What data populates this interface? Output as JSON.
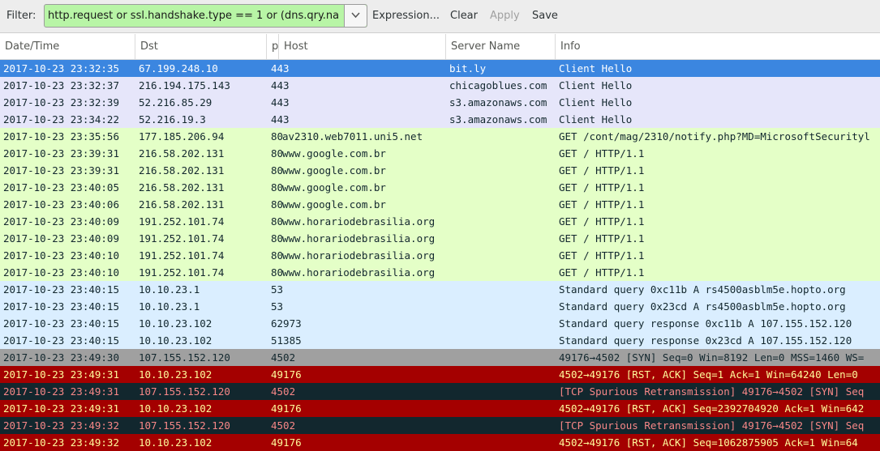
{
  "toolbar": {
    "filter_label": "Filter:",
    "filter_value": "http.request or ssl.handshake.type == 1 or (dns.qry.na",
    "expression_label": "Expression...",
    "clear_label": "Clear",
    "apply_label": "Apply",
    "save_label": "Save",
    "filter_valid_color": "#b8f5a6"
  },
  "columns": [
    "Date/Time",
    "Dst",
    "port",
    "Host",
    "Server Name",
    "Info"
  ],
  "row_styles": {
    "selected": {
      "bg": "#3b86e0",
      "fg": "#ffffff"
    },
    "tls": {
      "bg": "#e6e6fa",
      "fg": "#12272e"
    },
    "http": {
      "bg": "#e4ffc7",
      "fg": "#12272e"
    },
    "dns": {
      "bg": "#daeeff",
      "fg": "#12272e"
    },
    "tcp_gray": {
      "bg": "#a0a0a0",
      "fg": "#12272e"
    },
    "tcp_rst": {
      "bg": "#a40000",
      "fg": "#fffc9c"
    },
    "tcp_bad": {
      "bg": "#12272e",
      "fg": "#f78787"
    }
  },
  "rows": [
    {
      "dt": "2017-10-23 23:32:35",
      "dst": "67.199.248.10",
      "port": "443",
      "host": "",
      "server": "bit.ly",
      "info": "Client Hello",
      "style": "selected"
    },
    {
      "dt": "2017-10-23 23:32:37",
      "dst": "216.194.175.143",
      "port": "443",
      "host": "",
      "server": "chicagoblues.com",
      "info": "Client Hello",
      "style": "tls"
    },
    {
      "dt": "2017-10-23 23:32:39",
      "dst": "52.216.85.29",
      "port": "443",
      "host": "",
      "server": "s3.amazonaws.com",
      "info": "Client Hello",
      "style": "tls"
    },
    {
      "dt": "2017-10-23 23:34:22",
      "dst": "52.216.19.3",
      "port": "443",
      "host": "",
      "server": "s3.amazonaws.com",
      "info": "Client Hello",
      "style": "tls"
    },
    {
      "dt": "2017-10-23 23:35:56",
      "dst": "177.185.206.94",
      "port": "80",
      "host": "av2310.web7011.uni5.net",
      "server": "",
      "info": "GET /cont/mag/2310/notify.php?MD=MicrosoftSecurityl",
      "style": "http"
    },
    {
      "dt": "2017-10-23 23:39:31",
      "dst": "216.58.202.131",
      "port": "80",
      "host": "www.google.com.br",
      "server": "",
      "info": "GET / HTTP/1.1",
      "style": "http"
    },
    {
      "dt": "2017-10-23 23:39:31",
      "dst": "216.58.202.131",
      "port": "80",
      "host": "www.google.com.br",
      "server": "",
      "info": "GET / HTTP/1.1",
      "style": "http"
    },
    {
      "dt": "2017-10-23 23:40:05",
      "dst": "216.58.202.131",
      "port": "80",
      "host": "www.google.com.br",
      "server": "",
      "info": "GET / HTTP/1.1",
      "style": "http"
    },
    {
      "dt": "2017-10-23 23:40:06",
      "dst": "216.58.202.131",
      "port": "80",
      "host": "www.google.com.br",
      "server": "",
      "info": "GET / HTTP/1.1",
      "style": "http"
    },
    {
      "dt": "2017-10-23 23:40:09",
      "dst": "191.252.101.74",
      "port": "80",
      "host": "www.horariodebrasilia.org",
      "server": "",
      "info": "GET / HTTP/1.1",
      "style": "http"
    },
    {
      "dt": "2017-10-23 23:40:09",
      "dst": "191.252.101.74",
      "port": "80",
      "host": "www.horariodebrasilia.org",
      "server": "",
      "info": "GET / HTTP/1.1",
      "style": "http"
    },
    {
      "dt": "2017-10-23 23:40:10",
      "dst": "191.252.101.74",
      "port": "80",
      "host": "www.horariodebrasilia.org",
      "server": "",
      "info": "GET / HTTP/1.1",
      "style": "http"
    },
    {
      "dt": "2017-10-23 23:40:10",
      "dst": "191.252.101.74",
      "port": "80",
      "host": "www.horariodebrasilia.org",
      "server": "",
      "info": "GET / HTTP/1.1",
      "style": "http"
    },
    {
      "dt": "2017-10-23 23:40:15",
      "dst": "10.10.23.1",
      "port": "53",
      "host": "",
      "server": "",
      "info": "Standard query 0xc11b  A rs4500asblm5e.hopto.org",
      "style": "dns"
    },
    {
      "dt": "2017-10-23 23:40:15",
      "dst": "10.10.23.1",
      "port": "53",
      "host": "",
      "server": "",
      "info": "Standard query 0x23cd  A rs4500asblm5e.hopto.org",
      "style": "dns"
    },
    {
      "dt": "2017-10-23 23:40:15",
      "dst": "10.10.23.102",
      "port": "62973",
      "host": "",
      "server": "",
      "info": "Standard query response 0xc11b  A 107.155.152.120",
      "style": "dns"
    },
    {
      "dt": "2017-10-23 23:40:15",
      "dst": "10.10.23.102",
      "port": "51385",
      "host": "",
      "server": "",
      "info": "Standard query response 0x23cd  A 107.155.152.120",
      "style": "dns"
    },
    {
      "dt": "2017-10-23 23:49:30",
      "dst": "107.155.152.120",
      "port": "4502",
      "host": "",
      "server": "",
      "info": "49176→4502 [SYN] Seq=0 Win=8192 Len=0 MSS=1460 WS=",
      "style": "tcp_gray"
    },
    {
      "dt": "2017-10-23 23:49:31",
      "dst": "10.10.23.102",
      "port": "49176",
      "host": "",
      "server": "",
      "info": "4502→49176 [RST, ACK] Seq=1 Ack=1 Win=64240 Len=0",
      "style": "tcp_rst"
    },
    {
      "dt": "2017-10-23 23:49:31",
      "dst": "107.155.152.120",
      "port": "4502",
      "host": "",
      "server": "",
      "info": "[TCP Spurious Retransmission] 49176→4502 [SYN] Seq",
      "style": "tcp_bad"
    },
    {
      "dt": "2017-10-23 23:49:31",
      "dst": "10.10.23.102",
      "port": "49176",
      "host": "",
      "server": "",
      "info": "4502→49176 [RST, ACK] Seq=2392704920 Ack=1 Win=642",
      "style": "tcp_rst"
    },
    {
      "dt": "2017-10-23 23:49:32",
      "dst": "107.155.152.120",
      "port": "4502",
      "host": "",
      "server": "",
      "info": "[TCP Spurious Retransmission] 49176→4502 [SYN] Seq",
      "style": "tcp_bad"
    },
    {
      "dt": "2017-10-23 23:49:32",
      "dst": "10.10.23.102",
      "port": "49176",
      "host": "",
      "server": "",
      "info": "4502→49176 [RST, ACK] Seq=1062875905 Ack=1 Win=64",
      "style": "tcp_rst"
    }
  ]
}
